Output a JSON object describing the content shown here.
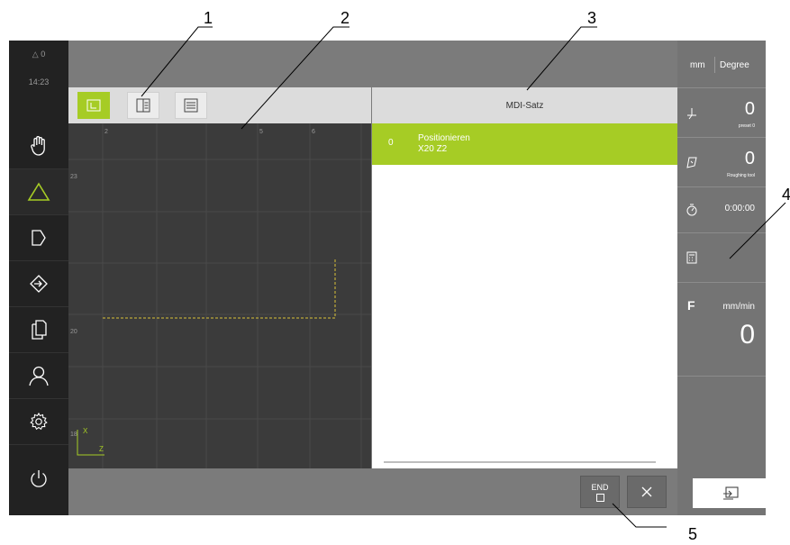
{
  "callouts": [
    "1",
    "2",
    "3",
    "4",
    "5"
  ],
  "sidebar": {
    "status_counter": "△ 0",
    "time": "14:23",
    "items": [
      {
        "icon": "hand-icon"
      },
      {
        "icon": "triangle-icon"
      },
      {
        "icon": "tag-icon"
      },
      {
        "icon": "sign-in-icon"
      },
      {
        "icon": "documents-icon"
      },
      {
        "icon": "user-icon"
      },
      {
        "icon": "gear-icon"
      },
      {
        "icon": "power-icon"
      }
    ]
  },
  "toolbar": {
    "buttons": [
      {
        "icon": "graphic-view-icon",
        "active": true
      },
      {
        "icon": "split-view-icon",
        "active": false
      },
      {
        "icon": "list-view-icon",
        "active": false
      }
    ]
  },
  "graphics": {
    "top_ticks": [
      "2",
      "5",
      "6"
    ],
    "left_ticks": [
      "23",
      "20",
      "18"
    ],
    "axis_x": "X",
    "axis_z": "Z"
  },
  "mdi": {
    "title": "MDI-Satz",
    "rows": [
      {
        "index": "0",
        "line1": "Positionieren",
        "line2": "X20 Z2"
      }
    ]
  },
  "bottombar": {
    "end_label": "END",
    "close_icon": "close-icon"
  },
  "rightpanel": {
    "unit_mm": "mm",
    "unit_degree": "Degree",
    "preset_value": "0",
    "preset_label": "preset 0",
    "tool_value": "0",
    "tool_label": "Roughing tool",
    "timer_value": "0:00:00",
    "feed_letter": "F",
    "feed_unit": "mm/min",
    "feed_value": "0"
  },
  "colors": {
    "accent": "#a6cc25",
    "sidebar": "#222222",
    "panel": "#747474",
    "graphics_bg": "#3b3b3b"
  }
}
